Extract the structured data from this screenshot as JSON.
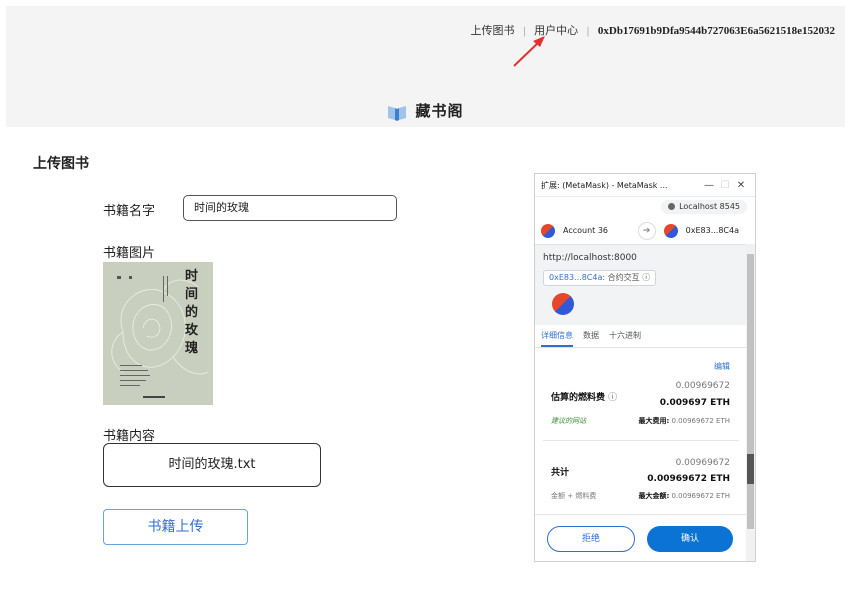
{
  "header": {
    "nav_upload": "上传图书",
    "nav_user_center": "用户中心",
    "nav_separator": "|",
    "wallet_address": "0xDb17691b9Dfa9544b727063E6a5621518e152032",
    "brand": "藏书阁",
    "arrow_color": "#e0302f"
  },
  "form": {
    "section_title": "上传图书",
    "name_label": "书籍名字",
    "name_value": "时间的玫瑰",
    "image_label": "书籍图片",
    "cover_title": "时间的玫瑰",
    "content_label": "书籍内容",
    "content_file": "时间的玫瑰.txt",
    "submit_label": "书籍上传"
  },
  "metamask": {
    "window_title": "扩展: (MetaMask) - MetaMask ...",
    "network": "Localhost 8545",
    "from_account": "Account 36",
    "to_account": "0xE83...8C4a",
    "origin": "http://localhost:8000",
    "contract_address": "0xE83...8C4a",
    "contract_suffix": ": 合约交互",
    "tabs": [
      "详细信息",
      "数据",
      "十六进制"
    ],
    "active_tab": 0,
    "edit_label": "编辑",
    "gas_fee_top": "0.00969672",
    "gas_label": "估算的燃料费",
    "gas_fee_eth": "0.009697 ETH",
    "suggested_site": "建议的网站",
    "max_fee_label": "最大费用:",
    "max_fee_value": "0.00969672 ETH",
    "total_top": "0.00969672",
    "total_label": "共计",
    "total_eth": "0.00969672 ETH",
    "amount_plus_fee": "金额 + 燃料费",
    "max_amount_label": "最大金额:",
    "max_amount_value": "0.00969672 ETH",
    "reject_label": "拒绝",
    "confirm_label": "确认",
    "accent_color": "#0a73d4"
  }
}
